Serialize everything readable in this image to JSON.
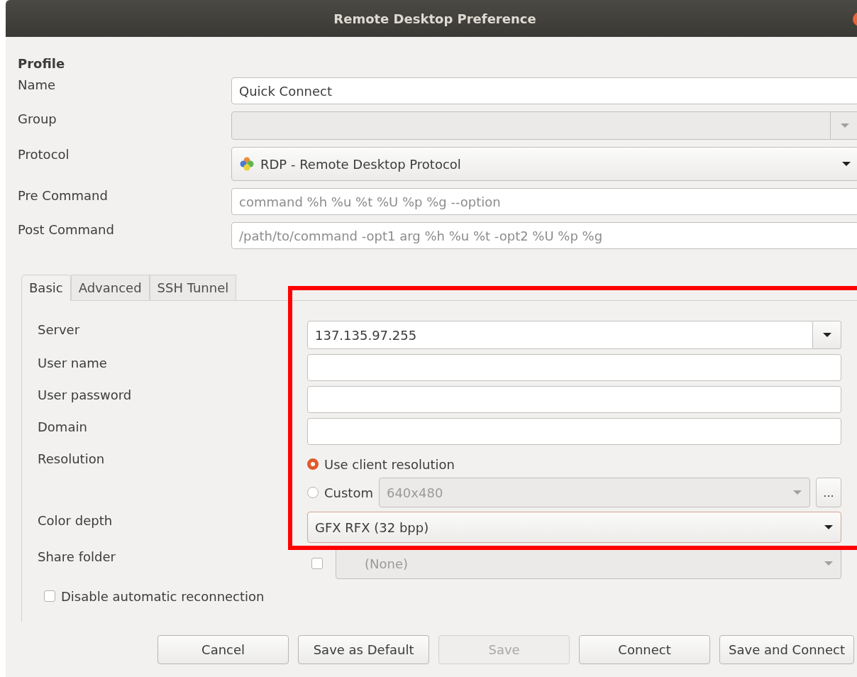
{
  "window": {
    "title": "Remote Desktop Preference"
  },
  "profile": {
    "heading": "Profile",
    "fields": [
      {
        "label": "Name",
        "kind": "text",
        "value": "Quick Connect"
      },
      {
        "label": "Group",
        "kind": "combo",
        "disabled": true
      },
      {
        "label": "Protocol",
        "kind": "dropdown",
        "value": "RDP - Remote Desktop Protocol"
      },
      {
        "label": "Pre Command",
        "kind": "text",
        "placeholder": "command %h %u %t %U %p %g --option"
      },
      {
        "label": "Post Command",
        "kind": "text",
        "placeholder": "/path/to/command -opt1 arg %h %u %t -opt2 %U %p %g"
      }
    ]
  },
  "tabs": [
    {
      "label": "Basic",
      "selected": true
    },
    {
      "label": "Advanced",
      "selected": false
    },
    {
      "label": "SSH Tunnel",
      "selected": false
    }
  ],
  "basic": {
    "fields": [
      {
        "label": "Server",
        "kind": "combo",
        "value": "137.135.97.255"
      },
      {
        "label": "User name",
        "kind": "text"
      },
      {
        "label": "User password",
        "kind": "text"
      },
      {
        "label": "Domain",
        "kind": "text"
      },
      {
        "label": "Resolution",
        "kind": "resolution",
        "options": [
          {
            "label": "Use client resolution",
            "selected": true
          },
          {
            "label": "Custom",
            "selected": false,
            "value": "640x480",
            "button": "..."
          }
        ]
      },
      {
        "label": "Color depth",
        "kind": "dropdown",
        "value": "GFX RFX (32 bpp)",
        "focused": true
      },
      {
        "label": "Share folder",
        "kind": "folder",
        "checked": false,
        "value": "(None)",
        "disabled": true
      }
    ],
    "reconnect": {
      "label": "Disable automatic reconnection",
      "checked": false
    }
  },
  "buttons": [
    {
      "label": "Cancel",
      "disabled": false
    },
    {
      "label": "Save as Default",
      "disabled": false
    },
    {
      "label": "Save",
      "disabled": true
    },
    {
      "label": "Connect",
      "disabled": false
    },
    {
      "label": "Save and Connect",
      "disabled": false
    }
  ],
  "highlight": {
    "kind": "frame"
  }
}
